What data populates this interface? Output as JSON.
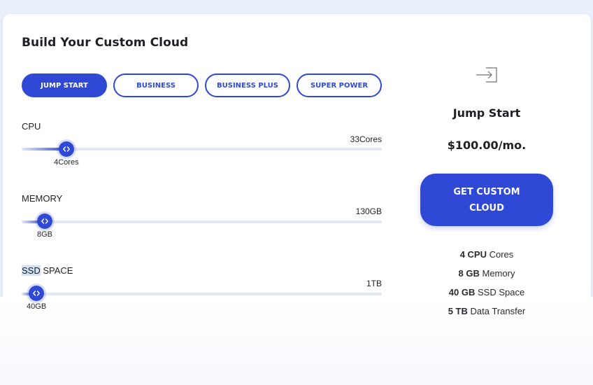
{
  "title": "Build Your Custom Cloud",
  "tabs": [
    {
      "label": "JUMP START",
      "active": true
    },
    {
      "label": "BUSINESS",
      "active": false
    },
    {
      "label": "BUSINESS PLUS",
      "active": false
    },
    {
      "label": "SUPER POWER",
      "active": false
    }
  ],
  "sliders": {
    "cpu": {
      "label": "CPU",
      "max_label": "33Cores",
      "value_label": "4Cores",
      "fraction": 0.124
    },
    "memory": {
      "label": "MEMORY",
      "max_label": "130GB",
      "value_label": "8GB",
      "fraction": 0.064
    },
    "ssd": {
      "label_highlight": "SSD",
      "label_rest": " SPACE",
      "max_label": "1TB",
      "value_label": "40GB",
      "fraction": 0.041
    }
  },
  "summary": {
    "icon": "sign-in-icon",
    "plan_name": "Jump Start",
    "price": "$100.00/mo.",
    "cta_label": "GET CUSTOM CLOUD",
    "specs": [
      {
        "value": "4 CPU",
        "unit": " Cores"
      },
      {
        "value": "8 GB",
        "unit": " Memory"
      },
      {
        "value": "40 GB",
        "unit": " SSD Space"
      },
      {
        "value": "5 TB",
        "unit": " Data Transfer"
      }
    ]
  },
  "colors": {
    "accent": "#2f49d6",
    "track": "#e3e8f6",
    "background": "#e9f0fb"
  }
}
